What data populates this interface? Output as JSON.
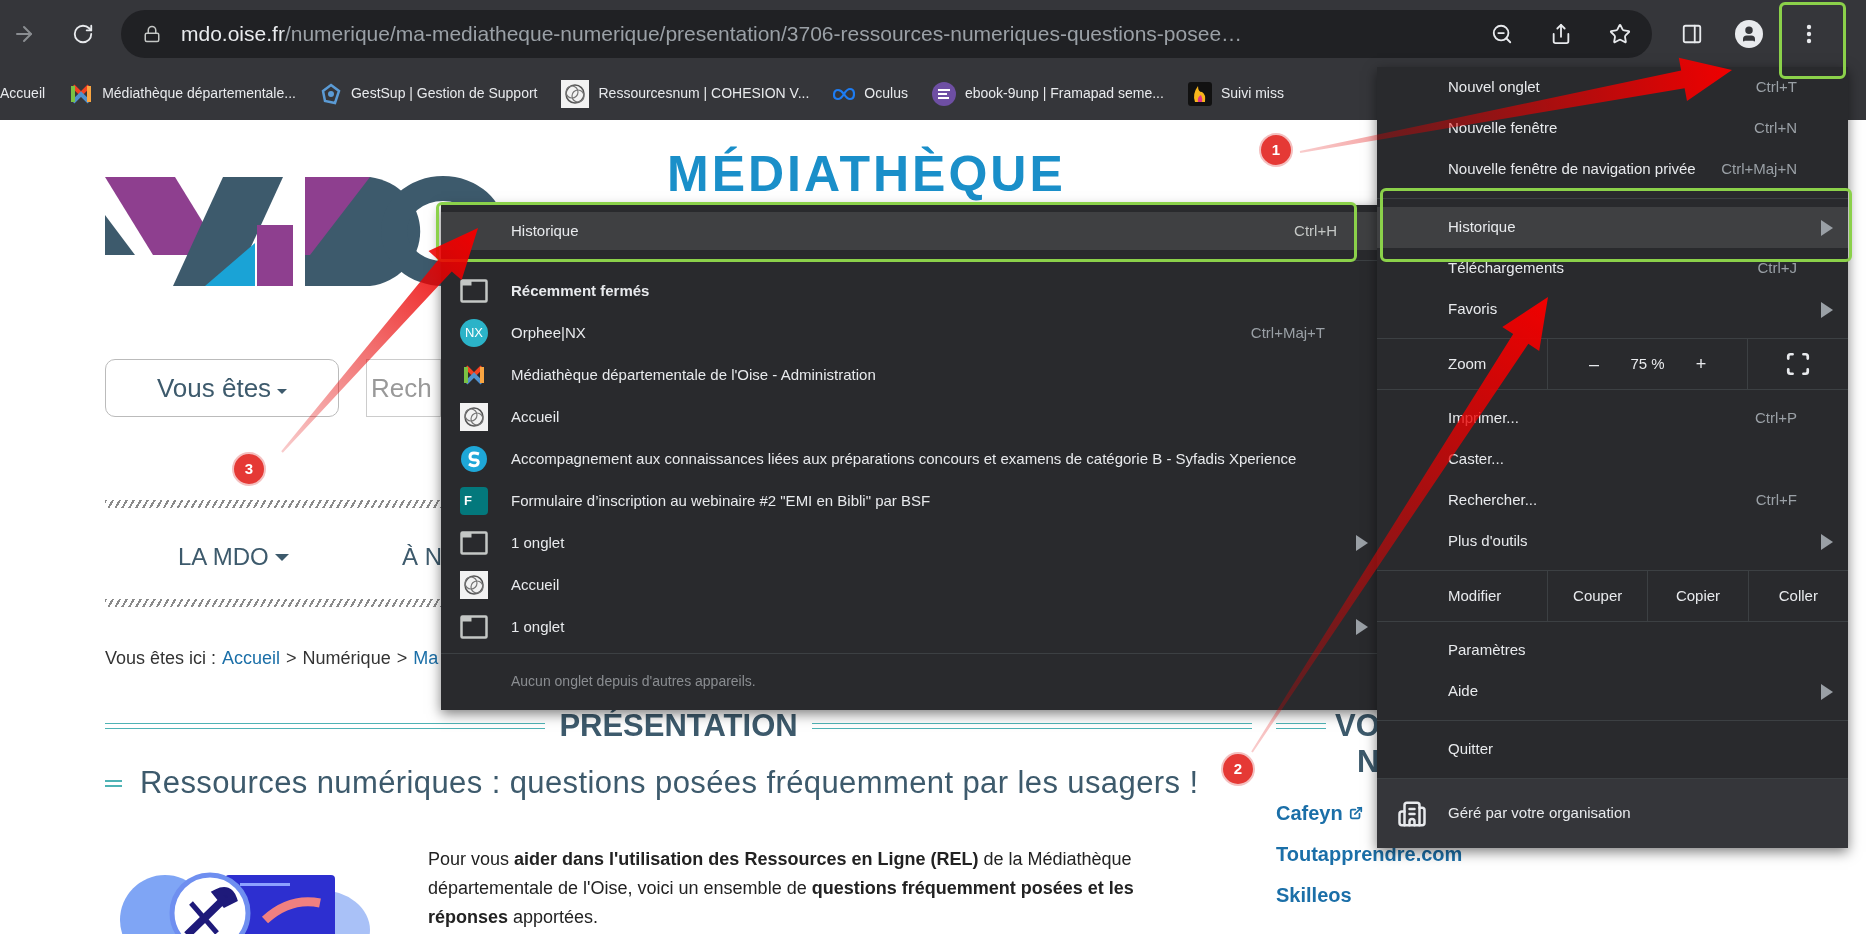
{
  "browser_toolbar": {
    "url_host": "mdo.oise.fr",
    "url_path": "/numerique/ma-mediatheque-numerique/presentation/3706-ressources-numeriques-questions-posee…"
  },
  "bookmarks": [
    {
      "label": "Accueil"
    },
    {
      "label": "Médiathèque départementale..."
    },
    {
      "label": "GestSup | Gestion de Support"
    },
    {
      "label": "Ressourcesnum | COHESION V..."
    },
    {
      "label": "Oculus"
    },
    {
      "label": "ebook-9unp | Framapad seme..."
    },
    {
      "label": "Suivi miss"
    }
  ],
  "page": {
    "logo_word": "MÉDIATHÈQUE",
    "audience_button": "Vous êtes",
    "search": {
      "placeholder": "Rech"
    },
    "nav": [
      {
        "label": "LA MDO",
        "dropdown": true
      },
      {
        "label": "À N",
        "dropdown": false
      }
    ],
    "breadcrumb": {
      "prefix": "Vous êtes ici :",
      "separator": ">",
      "items": [
        {
          "label": "Accueil",
          "link": true
        },
        {
          "label": "Numérique",
          "link": false
        },
        {
          "label": "Ma",
          "link": true
        }
      ]
    },
    "section_title": "PRÉSENTATION",
    "article_title": "Ressources numériques : questions posées fréquemment par les usagers !",
    "intro": "Pour vous **aider dans l'utilisation des Ressources en Ligne (REL)** de la Médiathèque départementale de l'Oise, voici un ensemble de **questions fréquemment posées et les réponses** apportées.",
    "sidebar": {
      "heading_lines": [
        "VO",
        "N"
      ],
      "links": [
        {
          "label": "Cafeyn",
          "external": true
        },
        {
          "label": "Toutapprendre.com",
          "external": false
        },
        {
          "label": "Skilleos",
          "external": false
        }
      ]
    }
  },
  "history_submenu": {
    "items": [
      {
        "kind": "command",
        "label": "Historique",
        "shortcut": "Ctrl+H",
        "selected": true
      },
      {
        "kind": "heading",
        "label": "Récemment fermés",
        "selected": false
      },
      {
        "kind": "entry",
        "icon_text": "NX",
        "label": "Orphee|NX",
        "shortcut": "Ctrl+Maj+T",
        "selected": false
      },
      {
        "kind": "entry",
        "label": "Médiathèque départementale de l'Oise - Administration",
        "selected": false
      },
      {
        "kind": "entry",
        "label": "Accueil",
        "selected": false
      },
      {
        "kind": "entry",
        "label": "Accompagnement aux connaissances liées aux préparations concours et examens de catégorie B - Syfadis Xperience",
        "selected": false
      },
      {
        "kind": "entry",
        "icon_text": "F",
        "label": "Formulaire d’inscription au webinaire #2 \"EMI en Bibli\" par BSF",
        "selected": false
      },
      {
        "kind": "group",
        "label": "1 onglet",
        "selected": false
      },
      {
        "kind": "entry",
        "label": "Accueil",
        "selected": false
      },
      {
        "kind": "group",
        "label": "1 onglet",
        "selected": false
      }
    ],
    "footer": "Aucun onglet depuis d'autres appareils."
  },
  "app_menu": {
    "sections": [
      {
        "items": [
          {
            "kind": "item",
            "label": "Nouvel onglet",
            "shortcut": "Ctrl+T",
            "submenu": false,
            "selected": false
          },
          {
            "kind": "item",
            "label": "Nouvelle fenêtre",
            "shortcut": "Ctrl+N",
            "submenu": false,
            "selected": false
          },
          {
            "kind": "item",
            "label": "Nouvelle fenêtre de navigation privée",
            "shortcut": "Ctrl+Maj+N",
            "submenu": false,
            "selected": false
          }
        ]
      },
      {
        "items": [
          {
            "kind": "item",
            "label": "Historique",
            "submenu": true,
            "selected": true
          },
          {
            "kind": "item",
            "label": "Téléchargements",
            "shortcut": "Ctrl+J",
            "submenu": false,
            "selected": false
          },
          {
            "kind": "item",
            "label": "Favoris",
            "submenu": true,
            "selected": false
          }
        ]
      },
      {
        "items": [
          {
            "kind": "zoom",
            "label": "Zoom",
            "minus": "–",
            "value": "75 %",
            "plus": "+"
          }
        ]
      },
      {
        "items": [
          {
            "kind": "item",
            "label": "Imprimer...",
            "shortcut": "Ctrl+P",
            "submenu": false,
            "selected": false
          },
          {
            "kind": "item",
            "label": "Caster...",
            "submenu": false,
            "selected": false
          },
          {
            "kind": "item",
            "label": "Rechercher...",
            "shortcut": "Ctrl+F",
            "submenu": false,
            "selected": false
          },
          {
            "kind": "item",
            "label": "Plus d'outils",
            "submenu": true,
            "selected": false
          }
        ]
      },
      {
        "items": [
          {
            "kind": "edit",
            "label": "Modifier",
            "actions": [
              "Couper",
              "Copier",
              "Coller"
            ]
          }
        ]
      },
      {
        "items": [
          {
            "kind": "item",
            "label": "Paramètres",
            "submenu": false,
            "selected": false
          },
          {
            "kind": "item",
            "label": "Aide",
            "submenu": true,
            "selected": false
          }
        ]
      },
      {
        "items": [
          {
            "kind": "item",
            "label": "Quitter",
            "submenu": false,
            "selected": false
          }
        ]
      },
      {
        "items": [
          {
            "kind": "managed",
            "label": "Géré par votre organisation"
          }
        ]
      }
    ]
  },
  "annotations": {
    "badges": [
      "1",
      "2",
      "3"
    ]
  }
}
